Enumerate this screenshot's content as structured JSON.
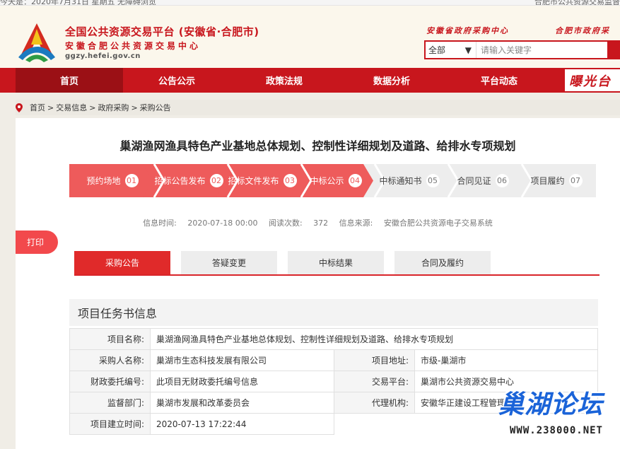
{
  "topbar": {
    "left_text": "今天是：2020年7月31日   星期五   无障碍浏览",
    "right_text": "合肥市公共资源交易监督"
  },
  "header": {
    "title": "全国公共资源交易平台 (安徽省·合肥市)",
    "subtitle": "安徽合肥公共资源交易中心",
    "url": "ggzy.hefei.gov.cn",
    "slogan_left": "安徽省政府采购中心",
    "slogan_right": "合肥市政府采",
    "search": {
      "selected": "全部",
      "placeholder": "请输入关键字"
    }
  },
  "nav": {
    "items": [
      "首页",
      "公告公示",
      "政策法规",
      "数据分析",
      "平台动态"
    ],
    "banner": "曝光台"
  },
  "breadcrumb": [
    "首页",
    ">",
    "交易信息",
    ">",
    "政府采购",
    ">",
    "采购公告"
  ],
  "doc": {
    "title": "巢湖渔网渔具特色产业基地总体规划、控制性详细规划及道路、给排水专项规划"
  },
  "steps": [
    {
      "label": "预约场地",
      "num": "01",
      "done": true
    },
    {
      "label": "招标公告发布",
      "num": "02",
      "done": true
    },
    {
      "label": "招标文件发布",
      "num": "03",
      "done": true
    },
    {
      "label": "中标公示",
      "num": "04",
      "done": true
    },
    {
      "label": "中标通知书",
      "num": "05",
      "done": false
    },
    {
      "label": "合同见证",
      "num": "06",
      "done": false
    },
    {
      "label": "项目履约",
      "num": "07",
      "done": false
    }
  ],
  "meta": {
    "time_label": "信息时间:",
    "time": "2020-07-18 00:00",
    "views_label": "阅读次数:",
    "views": "372",
    "source_label": "信息来源:",
    "source": "安徽合肥公共资源电子交易系统"
  },
  "print_label": "打印",
  "tabs": [
    "采购公告",
    "答疑变更",
    "中标结果",
    "合同及履约"
  ],
  "section": {
    "title": "项目任务书信息"
  },
  "info": {
    "project_name_k": "项目名称:",
    "project_name_v": "巢湖渔网渔具特色产业基地总体规划、控制性详细规划及道路、给排水专项规划",
    "buyer_k": "采购人名称:",
    "buyer_v": "巢湖市生态科技发展有限公司",
    "address_k": "项目地址:",
    "address_v": "市级-巢湖市",
    "finance_k": "财政委托编号:",
    "finance_v": "此项目无财政委托编号信息",
    "platform_k": "交易平台:",
    "platform_v": "巢湖市公共资源交易中心",
    "supervisor_k": "监督部门:",
    "supervisor_v": "巢湖市发展和改革委员会",
    "agent_k": "代理机构:",
    "agent_v": "安徽华正建设工程管理",
    "created_k": "项目建立时间:",
    "created_v": "2020-07-13 17:22:44"
  },
  "watermark": {
    "title": "巢湖论坛",
    "url": "WWW.238000.NET"
  },
  "colors": {
    "brand_red": "#c8161d",
    "step_red": "#ee5b5b",
    "step_grey": "#ededed"
  }
}
